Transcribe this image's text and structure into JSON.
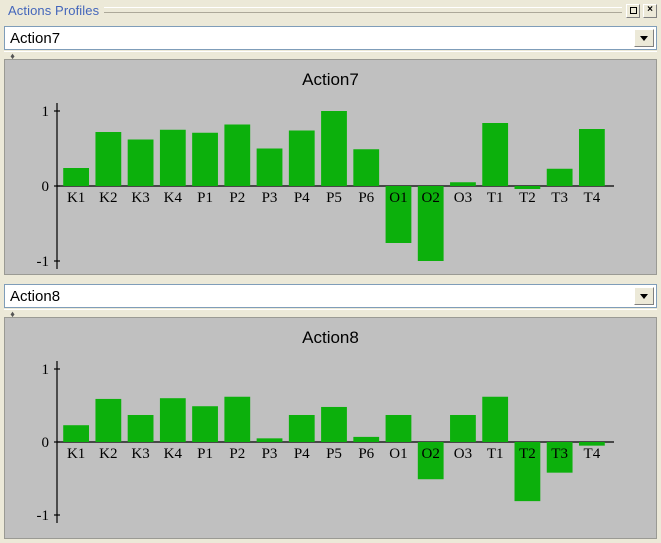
{
  "window": {
    "title": "Actions Profiles",
    "buttons": [
      {
        "name": "restore",
        "label": ""
      },
      {
        "name": "close",
        "label": "×"
      }
    ]
  },
  "panels": [
    {
      "combo": {
        "value": "Action7",
        "arrow": "chevron-down-icon"
      },
      "chart_index": 0
    },
    {
      "combo": {
        "value": "Action8",
        "arrow": "chevron-down-icon"
      },
      "chart_index": 1
    }
  ],
  "chart_data": [
    {
      "type": "bar",
      "title": "Action7",
      "xlabel": "",
      "ylabel": "",
      "ylim": [
        -1,
        1
      ],
      "yticks": [
        "1",
        "0",
        "-1"
      ],
      "ytick_values": [
        1,
        0,
        -1
      ],
      "grid": false,
      "legend": "none",
      "bar_color": "#0cb00c",
      "categories": [
        "K1",
        "K2",
        "K3",
        "K4",
        "P1",
        "P2",
        "P3",
        "P4",
        "P5",
        "P6",
        "O1",
        "O2",
        "O3",
        "T1",
        "T2",
        "T3",
        "T4"
      ],
      "values": [
        0.24,
        0.72,
        0.62,
        0.75,
        0.71,
        0.82,
        0.5,
        0.74,
        1.0,
        0.49,
        -0.76,
        -1.0,
        0.05,
        0.84,
        -0.04,
        0.23,
        0.76
      ]
    },
    {
      "type": "bar",
      "title": "Action8",
      "xlabel": "",
      "ylabel": "",
      "ylim": [
        -1,
        1
      ],
      "yticks": [
        "1",
        "0",
        "-1"
      ],
      "ytick_values": [
        1,
        0,
        -1
      ],
      "grid": false,
      "legend": "none",
      "bar_color": "#0cb00c",
      "categories": [
        "K1",
        "K2",
        "K3",
        "K4",
        "P1",
        "P2",
        "P3",
        "P4",
        "P5",
        "P6",
        "O1",
        "O2",
        "O3",
        "T1",
        "T2",
        "T3",
        "T4"
      ],
      "values": [
        0.23,
        0.59,
        0.37,
        0.6,
        0.49,
        0.62,
        0.05,
        0.37,
        0.48,
        0.07,
        0.37,
        -0.51,
        0.37,
        0.62,
        -0.81,
        -0.42,
        -0.05
      ]
    }
  ]
}
